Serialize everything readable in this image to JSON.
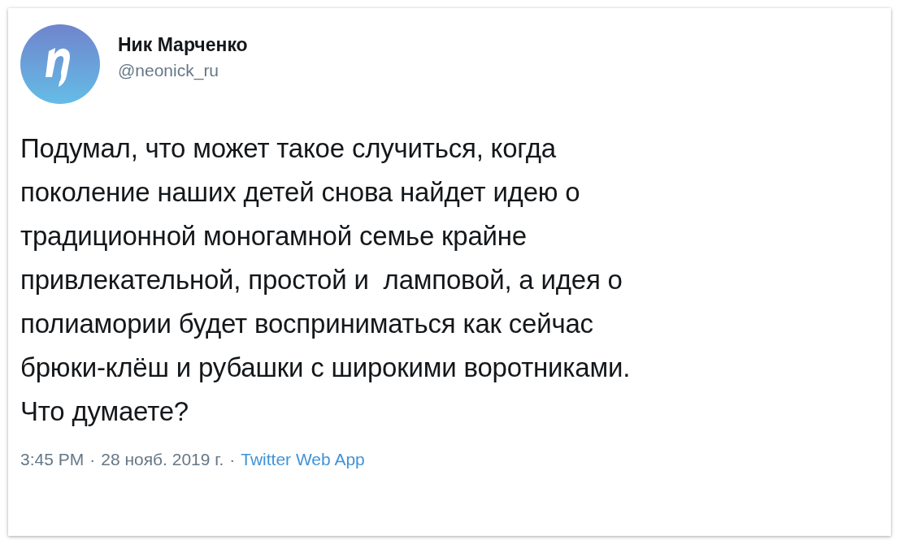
{
  "tweet": {
    "author": {
      "name": "Ник Марченко",
      "handle": "@neonick_ru"
    },
    "text": "Подумал, что может такое случиться, когда\nпоколение наших детей снова найдет идею о\nтрадиционной моногамной семье крайне\nпривлекательной, простой и  ламповой, а идея о\nполиамории будет восприниматься как сейчас\nбрюки-клёш и рубашки с широкими воротниками.\nЧто думаете?",
    "time": "3:45 PM",
    "separators": [
      "·",
      "·"
    ],
    "date": "28 нояб. 2019 г.",
    "source": "Twitter Web App"
  }
}
